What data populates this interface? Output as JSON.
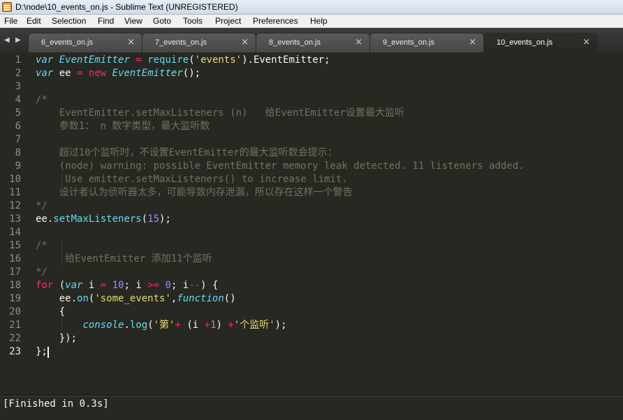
{
  "window": {
    "title": "D:\\node\\10_events_on.js - Sublime Text (UNREGISTERED)"
  },
  "menu": [
    "File",
    "Edit",
    "Selection",
    "Find",
    "View",
    "Goto",
    "Tools",
    "Project",
    "Preferences",
    "Help"
  ],
  "tabs": [
    {
      "label": "6_events_on.js",
      "close": "×"
    },
    {
      "label": "7_events_on.js",
      "close": "×"
    },
    {
      "label": "8_events_on.js",
      "close": "×"
    },
    {
      "label": "9_events_on.js",
      "close": "×"
    },
    {
      "label": "10_events_on.js",
      "close": "×",
      "active": true
    }
  ],
  "tab_nav": {
    "prev": "◀",
    "next": "▶"
  },
  "editor": {
    "current_line": 23,
    "line_numbers": [
      "1",
      "2",
      "3",
      "4",
      "5",
      "6",
      "7",
      "8",
      "9",
      "10",
      "11",
      "12",
      "13",
      "14",
      "15",
      "16",
      "17",
      "18",
      "19",
      "20",
      "21",
      "22",
      "23"
    ]
  },
  "output": {
    "text": "[Finished in 0.3s]"
  },
  "colors": {
    "background": "#272822",
    "keyword": "#66d9ef",
    "function": "#a6e22e",
    "string": "#e6db74",
    "operator": "#f92672",
    "number": "#ae81ff",
    "comment": "#75715e"
  }
}
